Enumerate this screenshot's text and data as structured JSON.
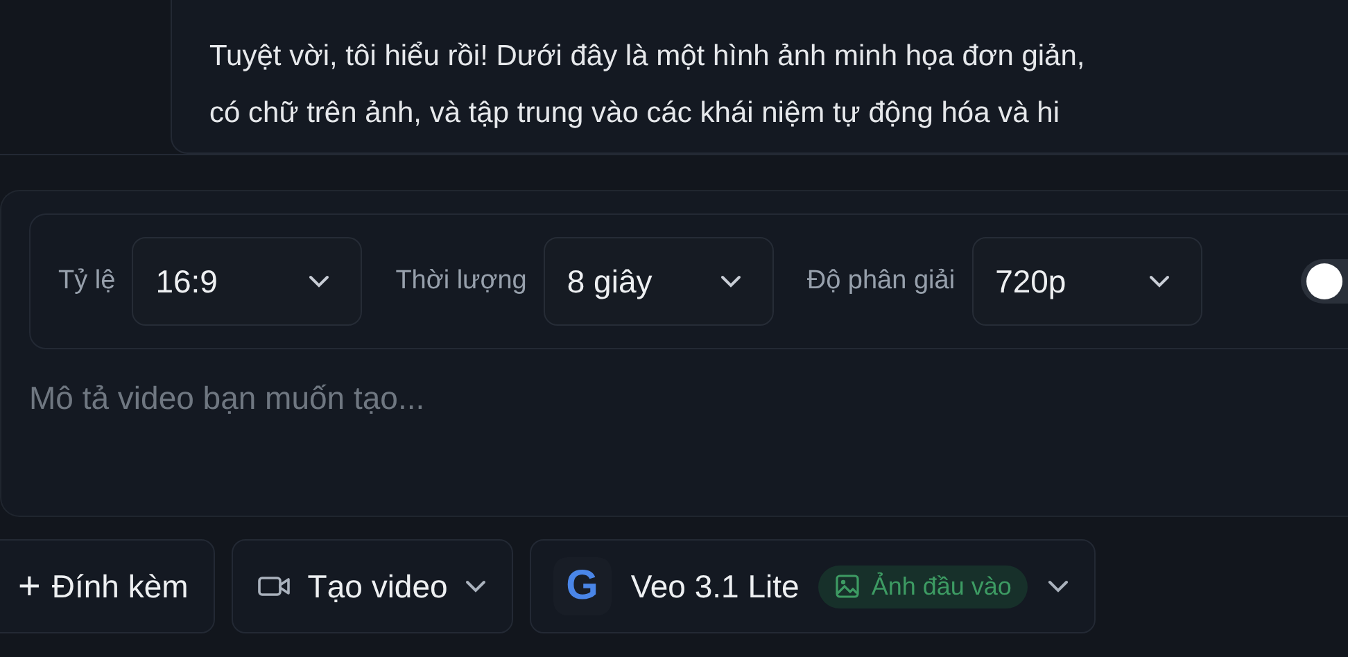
{
  "message": {
    "lines": [
      "Tuyệt vời, tôi hiểu rồi! Dưới đây là một hình ảnh minh họa đơn giản,",
      "có chữ trên ảnh, và tập trung vào các khái niệm tự động hóa và hi"
    ]
  },
  "settings": [
    {
      "label": "Tỷ lệ",
      "value": "16:9"
    },
    {
      "label": "Thời lượng",
      "value": "8 giây"
    },
    {
      "label": "Độ phân giải",
      "value": "720p"
    }
  ],
  "toggle": {
    "on": false
  },
  "prompt": {
    "placeholder": "Mô tả video bạn muốn tạo..."
  },
  "toolbar": {
    "attach": {
      "icon": "+",
      "label": "Đính kèm"
    },
    "mode": {
      "label": "Tạo video"
    },
    "model": {
      "logo": "G",
      "label": "Veo 3.1 Lite",
      "badge": "Ảnh đầu vào"
    }
  }
}
